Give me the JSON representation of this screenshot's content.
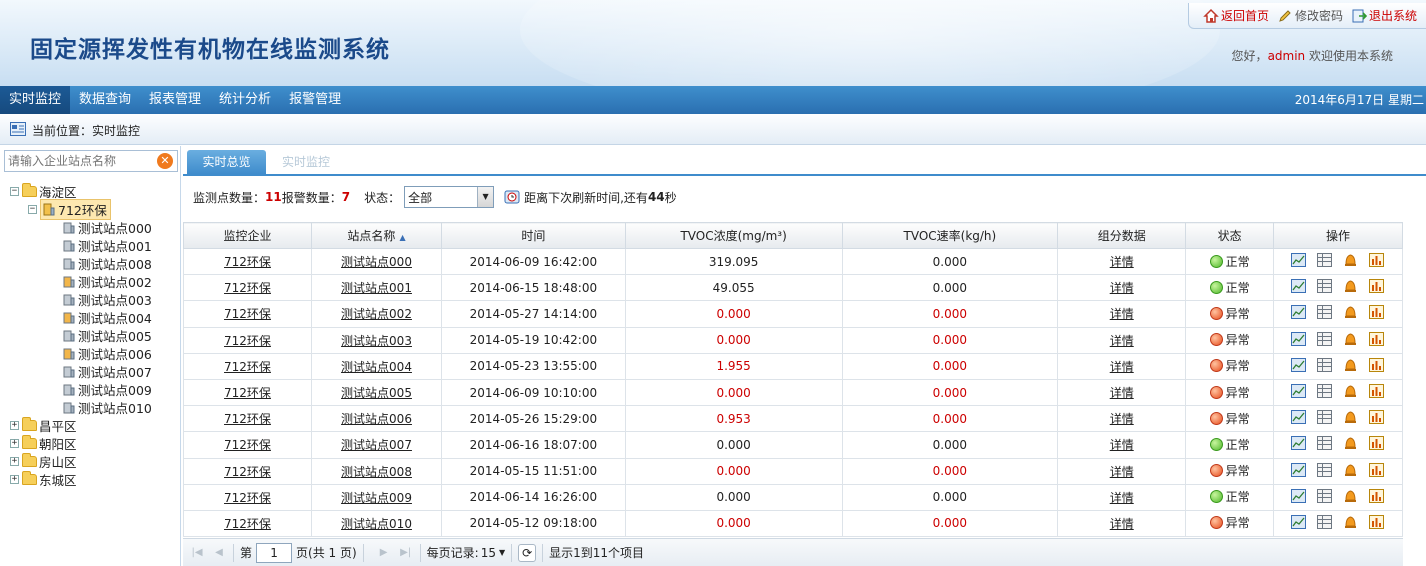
{
  "header": {
    "title": "固定源挥发性有机物在线监测系统",
    "links": [
      "返回首页",
      "修改密码",
      "退出系统"
    ],
    "welcome_prefix": "您好，",
    "username": "admin",
    "welcome_suffix": " 欢迎使用本系统"
  },
  "menu": {
    "items": [
      "实时监控",
      "数据查询",
      "报表管理",
      "统计分析",
      "报警管理"
    ],
    "date": "2014年6月17日 星期二"
  },
  "breadcrumb": "当前位置：实时监控",
  "sidebar": {
    "search_placeholder": "请输入企业站点名称",
    "tree": {
      "district_open": "海淀区",
      "company": "712环保",
      "stations": [
        "测试站点000",
        "测试站点001",
        "测试站点008",
        "测试站点002",
        "测试站点003",
        "测试站点004",
        "测试站点005",
        "测试站点006",
        "测试站点007",
        "测试站点009",
        "测试站点010"
      ],
      "other_districts": [
        "昌平区",
        "朝阳区",
        "房山区",
        "东城区"
      ]
    }
  },
  "tabs": [
    "实时总览",
    "实时监控"
  ],
  "toolbar": {
    "station_count_label": "监测点数量：",
    "station_count": "11",
    "alarm_count_label": " 报警数量：",
    "alarm_count": "7",
    "status_label": "状态：",
    "status_value": "全部",
    "refresh_prefix": "距离下次刷新时间,还有 ",
    "refresh_secs": "44",
    "refresh_suffix": " 秒"
  },
  "table": {
    "columns": [
      "监控企业",
      "站点名称",
      "时间",
      "TVOC浓度(mg/m³)",
      "TVOC速率(kg/h)",
      "组分数据",
      "状态",
      "操作"
    ],
    "detail_label": "详情",
    "rows": [
      {
        "company": "712环保",
        "station": "测试站点000",
        "time": "2014-06-09 16:42:00",
        "conc": "319.095",
        "rate": "0.000",
        "status": "正常",
        "ok": true
      },
      {
        "company": "712环保",
        "station": "测试站点001",
        "time": "2014-06-15 18:48:00",
        "conc": "49.055",
        "rate": "0.000",
        "status": "正常",
        "ok": true
      },
      {
        "company": "712环保",
        "station": "测试站点002",
        "time": "2014-05-27 14:14:00",
        "conc": "0.000",
        "rate": "0.000",
        "status": "异常",
        "ok": false
      },
      {
        "company": "712环保",
        "station": "测试站点003",
        "time": "2014-05-19 10:42:00",
        "conc": "0.000",
        "rate": "0.000",
        "status": "异常",
        "ok": false
      },
      {
        "company": "712环保",
        "station": "测试站点004",
        "time": "2014-05-23 13:55:00",
        "conc": "1.955",
        "rate": "0.000",
        "status": "异常",
        "ok": false
      },
      {
        "company": "712环保",
        "station": "测试站点005",
        "time": "2014-06-09 10:10:00",
        "conc": "0.000",
        "rate": "0.000",
        "status": "异常",
        "ok": false
      },
      {
        "company": "712环保",
        "station": "测试站点006",
        "time": "2014-05-26 15:29:00",
        "conc": "0.953",
        "rate": "0.000",
        "status": "异常",
        "ok": false
      },
      {
        "company": "712环保",
        "station": "测试站点007",
        "time": "2014-06-16 18:07:00",
        "conc": "0.000",
        "rate": "0.000",
        "status": "正常",
        "ok": true
      },
      {
        "company": "712环保",
        "station": "测试站点008",
        "time": "2014-05-15 11:51:00",
        "conc": "0.000",
        "rate": "0.000",
        "status": "异常",
        "ok": false
      },
      {
        "company": "712环保",
        "station": "测试站点009",
        "time": "2014-06-14 16:26:00",
        "conc": "0.000",
        "rate": "0.000",
        "status": "正常",
        "ok": true
      },
      {
        "company": "712环保",
        "station": "测试站点010",
        "time": "2014-05-12 09:18:00",
        "conc": "0.000",
        "rate": "0.000",
        "status": "异常",
        "ok": false
      }
    ]
  },
  "pager": {
    "page_prefix": "第",
    "page_value": "1",
    "page_suffix": "页(共 1 页)",
    "per_page_label": "每页记录:",
    "per_page_value": "15",
    "summary": "显示1到11个项目"
  },
  "colors": {
    "accent": "#2a6fb0",
    "alarm": "#cc0000",
    "ok": "#4fb82a",
    "bad": "#e74c1c"
  }
}
